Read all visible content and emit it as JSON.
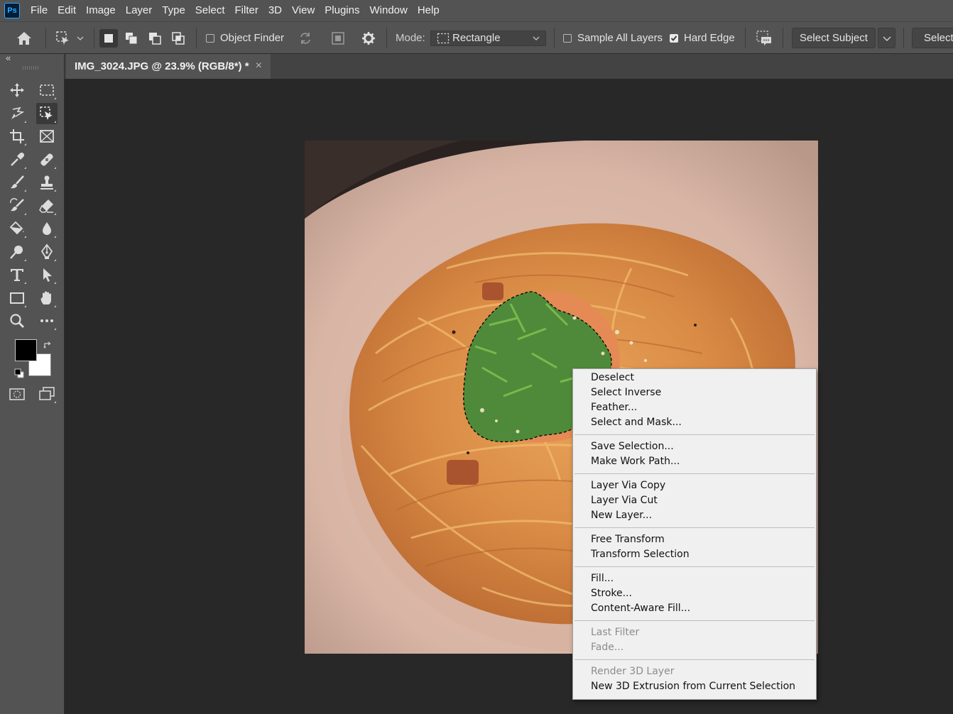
{
  "app": {
    "logo_text": "Ps",
    "accent_color": "#31a8ff"
  },
  "menubar": {
    "items": [
      "File",
      "Edit",
      "Image",
      "Layer",
      "Type",
      "Select",
      "Filter",
      "3D",
      "View",
      "Plugins",
      "Window",
      "Help"
    ]
  },
  "options_bar": {
    "object_finder_label": "Object Finder",
    "object_finder_checked": false,
    "mode_label": "Mode:",
    "mode_value": "Rectangle",
    "sample_all_layers_label": "Sample All Layers",
    "sample_all_layers_checked": false,
    "hard_edge_label": "Hard Edge",
    "hard_edge_checked": true,
    "select_subject_label": "Select Subject",
    "select_truncated_label": "Select"
  },
  "toolbox": {
    "collapse_glyph": "«",
    "tools": [
      "move-tool-icon",
      "rect-marquee-icon",
      "lasso-tool-icon",
      "object-selection-icon",
      "crop-tool-icon",
      "frame-tool-icon",
      "eyedropper-icon",
      "healing-brush-icon",
      "brush-tool-icon",
      "clone-stamp-icon",
      "history-brush-icon",
      "eraser-icon",
      "paint-bucket-icon",
      "blur-drop-icon",
      "dodge-tool-icon",
      "pen-tool-icon",
      "type-tool-icon",
      "path-selection-icon",
      "rectangle-shape-icon",
      "hand-tool-icon",
      "zoom-tool-icon",
      "more-tools-icon"
    ],
    "foreground_color": "#000000",
    "background_color": "#ffffff"
  },
  "document": {
    "tab_title": "IMG_3024.JPG @ 23.9% (RGB/8*) *",
    "close_glyph": "×"
  },
  "context_menu": {
    "groups": [
      [
        {
          "label": "Deselect",
          "enabled": true
        },
        {
          "label": "Select Inverse",
          "enabled": true
        },
        {
          "label": "Feather...",
          "enabled": true
        },
        {
          "label": "Select and Mask...",
          "enabled": true
        }
      ],
      [
        {
          "label": "Save Selection...",
          "enabled": true
        },
        {
          "label": "Make Work Path...",
          "enabled": true
        }
      ],
      [
        {
          "label": "Layer Via Copy",
          "enabled": true
        },
        {
          "label": "Layer Via Cut",
          "enabled": true
        },
        {
          "label": "New Layer...",
          "enabled": true
        }
      ],
      [
        {
          "label": "Free Transform",
          "enabled": true
        },
        {
          "label": "Transform Selection",
          "enabled": true
        }
      ],
      [
        {
          "label": "Fill...",
          "enabled": true
        },
        {
          "label": "Stroke...",
          "enabled": true
        },
        {
          "label": "Content-Aware Fill...",
          "enabled": true
        }
      ],
      [
        {
          "label": "Last Filter",
          "enabled": false
        },
        {
          "label": "Fade...",
          "enabled": false
        }
      ],
      [
        {
          "label": "Render 3D Layer",
          "enabled": false
        },
        {
          "label": "New 3D Extrusion from Current Selection",
          "enabled": true
        }
      ]
    ]
  }
}
